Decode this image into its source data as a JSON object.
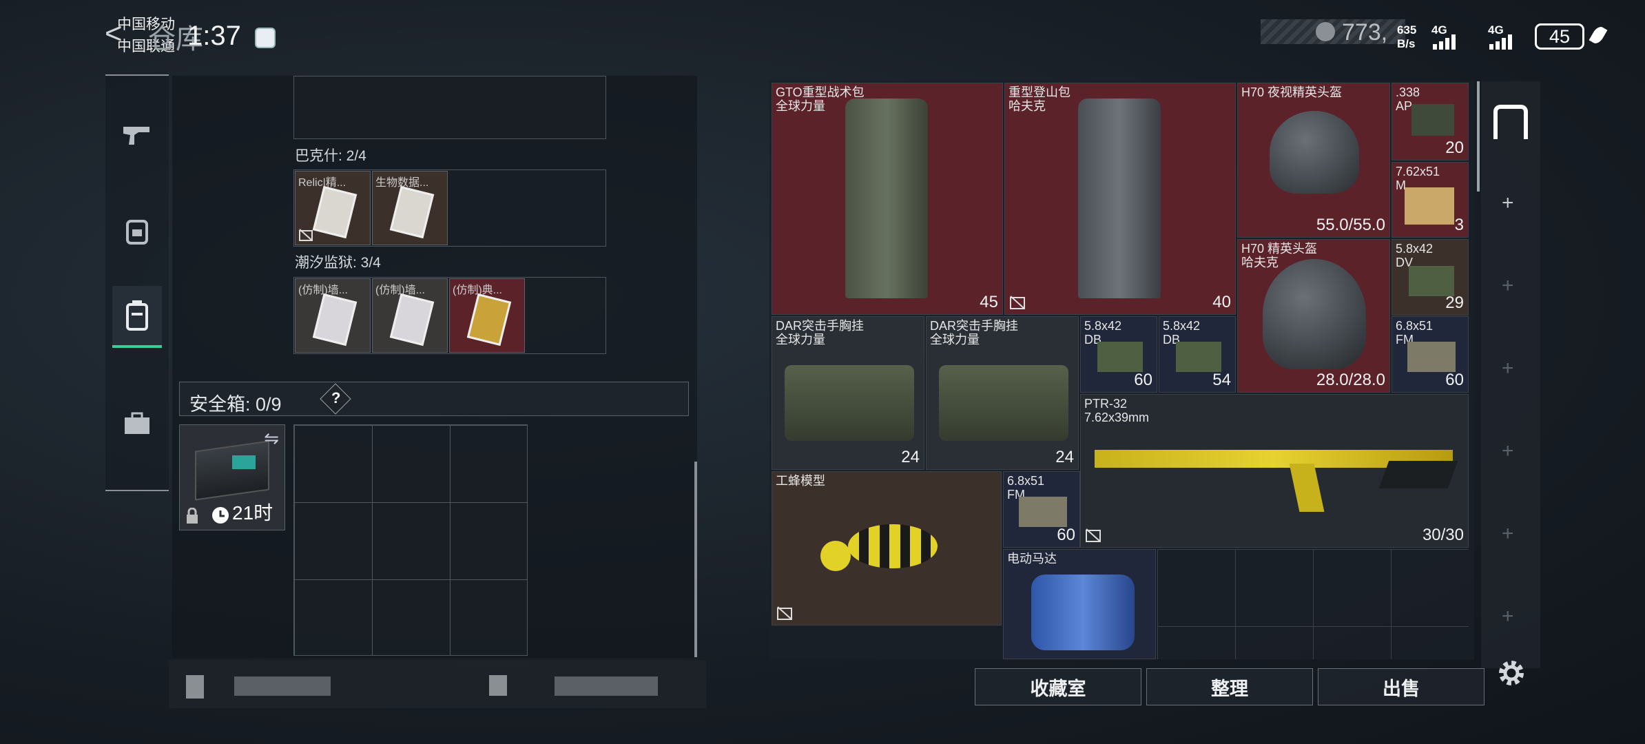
{
  "status_bar": {
    "carrier1": "中国移动",
    "carrier2": "中国联通",
    "time": "1:37",
    "net_speed_top": "635",
    "net_speed_bottom": "B/s",
    "net1": "4G",
    "net2": "4G",
    "battery": "45"
  },
  "header": {
    "back_label": "<",
    "title": "仓库",
    "currency": "773,"
  },
  "left_panel": {
    "container1_label": "巴克什: 2/4",
    "container1_items": [
      "Relic|精...",
      "生物数据..."
    ],
    "container2_label": "潮汐监狱: 3/4",
    "container2_items": [
      "(仿制)墙...",
      "(仿制)墙...",
      "(仿制)典..."
    ],
    "safebox_label": "安全箱: 0/9",
    "safebox_help": "?",
    "safebox_timer": "21时"
  },
  "stash_items": [
    {
      "name": "GTO重型战术包\n全球力量",
      "value": "45"
    },
    {
      "name": "重型登山包\n哈夫克",
      "value": "40"
    },
    {
      "name": "H70 夜视精英头盔",
      "value": "55.0/55.0"
    },
    {
      "name": ".338\nAP",
      "value": "20"
    },
    {
      "name": "7.62x51\nM",
      "value": "3"
    },
    {
      "name": "H70 精英头盔\n哈夫克",
      "value": "28.0/28.0"
    },
    {
      "name": "5.8x42\nDV",
      "value": "29"
    },
    {
      "name": "DAR突击手胸挂\n全球力量",
      "value": "24"
    },
    {
      "name": "DAR突击手胸挂\n全球力量",
      "value": "24"
    },
    {
      "name": "5.8x42\nDB",
      "value": "60"
    },
    {
      "name": "5.8x42\nDB",
      "value": "54"
    },
    {
      "name": "6.8x51\nFM",
      "value": "60"
    },
    {
      "name": "PTR-32\n7.62x39mm",
      "value": "30/30"
    },
    {
      "name": "工蜂模型",
      "value": ""
    },
    {
      "name": "6.8x51\nFM",
      "value": "60"
    },
    {
      "name": "电动马达",
      "value": ""
    }
  ],
  "bottom_buttons": [
    "收藏室",
    "整理",
    "出售"
  ],
  "colors": {
    "accent": "#2fd39a",
    "red_tile": "#5b2229",
    "brown_tile": "#3c302a",
    "navy_tile": "#20273a"
  },
  "icons": [
    "pistol-icon",
    "backpack-icon",
    "container-icon",
    "briefcase-icon",
    "gear-icon",
    "plus-icon",
    "lock-icon",
    "clock-icon",
    "swap-icon",
    "unbind-icon"
  ]
}
